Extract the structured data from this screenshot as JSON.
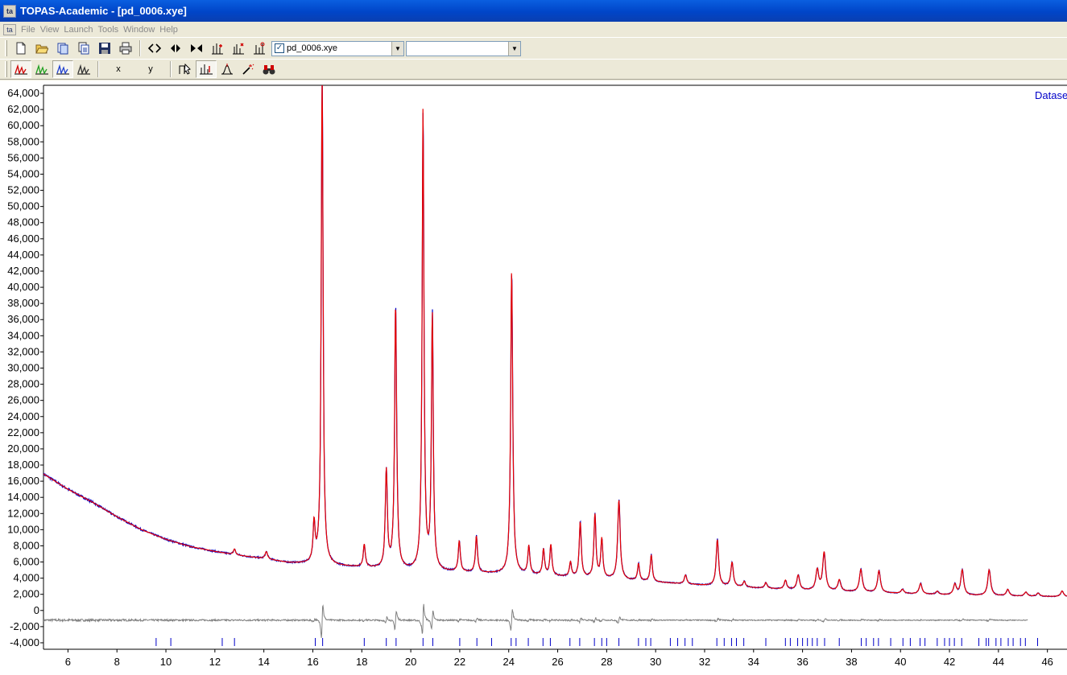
{
  "window": {
    "title": "TOPAS-Academic - [pd_0006.xye]",
    "app_icon": "ta"
  },
  "menu": {
    "mdi_icon": "ta",
    "items": [
      "File",
      "View",
      "Launch",
      "Tools",
      "Window",
      "Help"
    ]
  },
  "toolbar1": {
    "buttons": [
      "new-file-icon",
      "open-folder-icon",
      "open-inp-icon",
      "copy-doc-icon",
      "save-icon",
      "print-icon",
      "zoom-horizontal-icon",
      "zoom-in-icon",
      "zoom-out-icon",
      "peak-add-icon",
      "peak-fit-icon",
      "peak-select-icon"
    ],
    "dataset_checked": true,
    "dataset_combo": "pd_0006.xye",
    "second_combo": ""
  },
  "toolbar2": {
    "x_label": "x",
    "y_label": "y",
    "buttons": [
      "pattern-red-icon",
      "pattern-green-icon",
      "pattern-blue-icon",
      "pattern-black-icon",
      "cursor-tool-icon",
      "peak-marker-icon",
      "peak-single-icon",
      "magic-wand-icon",
      "binoculars-icon"
    ]
  },
  "chart_data": {
    "type": "line",
    "legend": "Datase",
    "xlim": [
      5,
      46.8
    ],
    "ylim": [
      -4800,
      65000
    ],
    "x_ticks": [
      6,
      8,
      10,
      12,
      14,
      16,
      18,
      20,
      22,
      24,
      26,
      28,
      30,
      32,
      34,
      36,
      38,
      40,
      42,
      44,
      46
    ],
    "y_ticks": [
      -4000,
      -2000,
      0,
      2000,
      4000,
      6000,
      8000,
      10000,
      12000,
      14000,
      16000,
      18000,
      20000,
      22000,
      24000,
      26000,
      28000,
      30000,
      32000,
      34000,
      36000,
      38000,
      40000,
      42000,
      44000,
      46000,
      48000,
      50000,
      52000,
      54000,
      56000,
      58000,
      60000,
      62000,
      64000
    ],
    "y_tick_labels": [
      "-4,000",
      "-2,000",
      "0",
      "2,000",
      "4,000",
      "6,000",
      "8,000",
      "10,000",
      "12,000",
      "14,000",
      "16,000",
      "18,000",
      "20,000",
      "22,000",
      "24,000",
      "26,000",
      "28,000",
      "30,000",
      "32,000",
      "34,000",
      "36,000",
      "38,000",
      "40,000",
      "42,000",
      "44,000",
      "46,000",
      "48,000",
      "50,000",
      "52,000",
      "54,000",
      "56,000",
      "58,000",
      "60,000",
      "62,000",
      "64,000"
    ],
    "background": [
      [
        5,
        16900
      ],
      [
        6,
        15000
      ],
      [
        7,
        13400
      ],
      [
        8,
        11600
      ],
      [
        9,
        10000
      ],
      [
        10,
        8800
      ],
      [
        11,
        7900
      ],
      [
        12,
        7300
      ],
      [
        13,
        6800
      ],
      [
        14,
        6400
      ],
      [
        15,
        5900
      ],
      [
        16,
        5700
      ],
      [
        18,
        5300
      ],
      [
        20,
        4900
      ],
      [
        22,
        4700
      ],
      [
        24,
        4500
      ],
      [
        26,
        4200
      ],
      [
        28,
        3900
      ],
      [
        30,
        3500
      ],
      [
        32,
        3100
      ],
      [
        34,
        2800
      ],
      [
        36,
        2500
      ],
      [
        38,
        2300
      ],
      [
        40,
        2100
      ],
      [
        42,
        1900
      ],
      [
        44,
        1800
      ],
      [
        46.8,
        1700
      ]
    ],
    "peaks": [
      [
        12.8,
        700,
        0.05
      ],
      [
        14.1,
        900,
        0.06
      ],
      [
        16.05,
        4800,
        0.05
      ],
      [
        16.38,
        61000,
        0.045
      ],
      [
        18.1,
        2800,
        0.05
      ],
      [
        19.0,
        12000,
        0.05
      ],
      [
        19.38,
        32500,
        0.05
      ],
      [
        20.5,
        56800,
        0.045
      ],
      [
        20.88,
        31500,
        0.045
      ],
      [
        21.98,
        3800,
        0.05
      ],
      [
        22.68,
        4500,
        0.05
      ],
      [
        24.12,
        37500,
        0.05
      ],
      [
        24.82,
        3500,
        0.05
      ],
      [
        25.42,
        3200,
        0.05
      ],
      [
        25.72,
        3800,
        0.05
      ],
      [
        26.52,
        1800,
        0.05
      ],
      [
        26.92,
        6800,
        0.05
      ],
      [
        27.52,
        7800,
        0.05
      ],
      [
        27.8,
        4800,
        0.05
      ],
      [
        28.5,
        9800,
        0.06
      ],
      [
        29.3,
        2100,
        0.05
      ],
      [
        29.82,
        3300,
        0.05
      ],
      [
        31.22,
        1100,
        0.06
      ],
      [
        32.52,
        5700,
        0.06
      ],
      [
        33.12,
        3000,
        0.06
      ],
      [
        33.62,
        700,
        0.06
      ],
      [
        34.5,
        700,
        0.06
      ],
      [
        35.3,
        1100,
        0.06
      ],
      [
        35.82,
        1800,
        0.07
      ],
      [
        36.6,
        2500,
        0.07
      ],
      [
        36.88,
        4700,
        0.07
      ],
      [
        37.5,
        1400,
        0.07
      ],
      [
        38.38,
        2800,
        0.07
      ],
      [
        39.12,
        2700,
        0.07
      ],
      [
        40.08,
        500,
        0.07
      ],
      [
        40.82,
        1300,
        0.07
      ],
      [
        41.5,
        400,
        0.07
      ],
      [
        42.22,
        1300,
        0.07
      ],
      [
        42.52,
        3100,
        0.07
      ],
      [
        43.62,
        3200,
        0.07
      ],
      [
        44.38,
        800,
        0.07
      ],
      [
        45.12,
        500,
        0.07
      ],
      [
        45.62,
        400,
        0.07
      ],
      [
        46.6,
        700,
        0.07
      ]
    ],
    "difference_offset": -1200,
    "difference_ends": [
      5,
      45.2
    ],
    "tick_positions": [
      9.6,
      10.2,
      12.3,
      12.8,
      16.1,
      16.4,
      18.1,
      19.0,
      19.4,
      20.5,
      20.9,
      22.0,
      22.7,
      23.3,
      24.1,
      24.3,
      24.8,
      25.4,
      25.7,
      26.5,
      26.9,
      27.5,
      27.8,
      28.0,
      28.5,
      29.3,
      29.6,
      29.8,
      30.6,
      30.9,
      31.2,
      31.5,
      32.5,
      32.8,
      33.1,
      33.3,
      33.6,
      34.5,
      35.3,
      35.5,
      35.8,
      36.0,
      36.2,
      36.4,
      36.6,
      36.9,
      37.5,
      38.4,
      38.6,
      38.9,
      39.1,
      39.6,
      40.1,
      40.4,
      40.8,
      41.0,
      41.5,
      41.8,
      42.0,
      42.2,
      42.5,
      43.2,
      43.5,
      43.6,
      43.9,
      44.1,
      44.4,
      44.6,
      44.9,
      45.1,
      45.6
    ],
    "colors": {
      "observed": "#0000c8",
      "calculated": "#e80000",
      "difference": "#808080",
      "ticks": "#0000c8",
      "legend": "#0000c8"
    }
  }
}
